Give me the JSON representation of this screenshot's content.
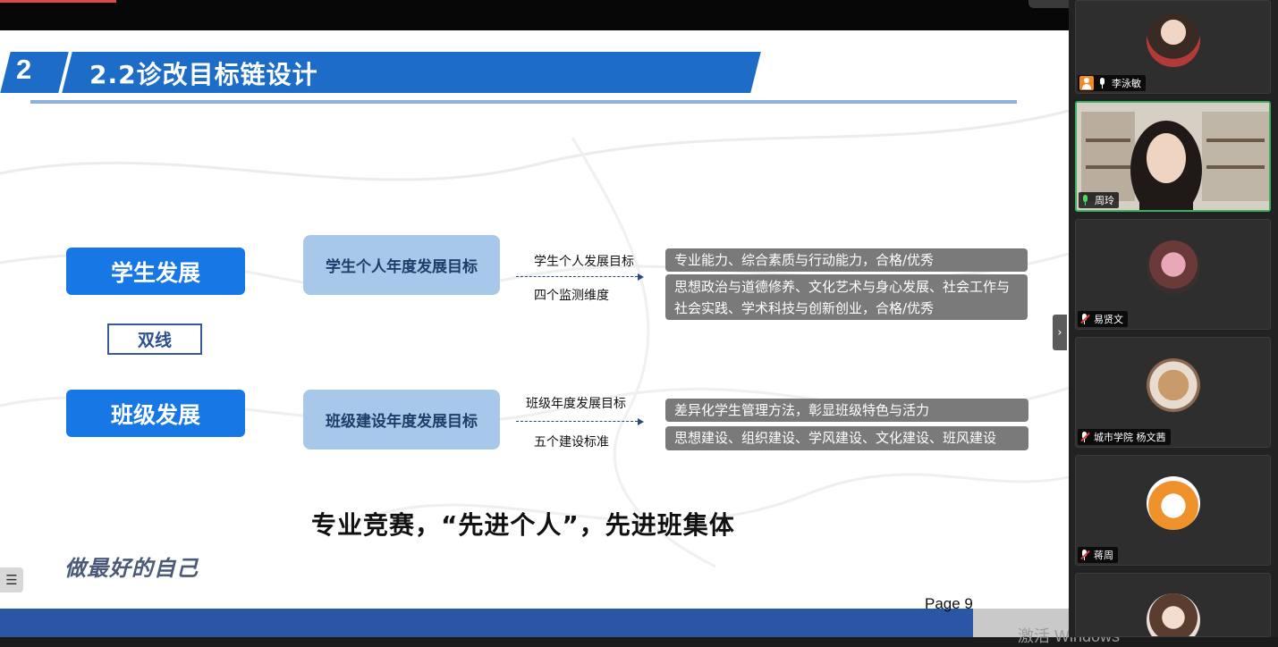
{
  "slide": {
    "section_number": "2",
    "title": "2.2诊改目标链设计",
    "left_pills": {
      "student": "学生发展",
      "dual": "双线",
      "class": "班级发展"
    },
    "rows": [
      {
        "target_box": "学生个人年度发展目标",
        "label_top": "学生个人发展目标",
        "label_bottom": "四个监测维度",
        "details": [
          "专业能力、综合素质与行动能力，合格/优秀",
          "思想政治与道德修养、文化艺术与身心发展、社会工作与社会实践、学术科技与创新创业，合格/优秀"
        ]
      },
      {
        "target_box": "班级建设年度发展目标",
        "label_top": "班级年度发展目标",
        "label_bottom": "五个建设标准",
        "details": [
          "差异化学生管理方法，彰显班级特色与活力",
          "思想建设、组织建设、学风建设、文化建设、班风建设"
        ]
      }
    ],
    "bottom_text": "专业竞赛，“先进个人”，先进班集体",
    "motto": "做最好的自己",
    "page_label": "Page 9",
    "accent_color": "#1d6cc8",
    "pill_color": "#1677e5"
  },
  "overlay": {
    "watermark": "激活 Windows",
    "list_button_icon": "list-icon",
    "collapse_icon": "chevron-right-icon"
  },
  "participants": [
    {
      "name": "李泳敏",
      "mic": "on",
      "badge": "person-icon"
    },
    {
      "name": "周玲",
      "mic": "speaking"
    },
    {
      "name": "易贤文",
      "mic": "muted"
    },
    {
      "name": "城市学院 杨文茜",
      "mic": "muted"
    },
    {
      "name": "蒋周",
      "mic": "muted"
    },
    {
      "name": "",
      "mic": "muted"
    }
  ]
}
